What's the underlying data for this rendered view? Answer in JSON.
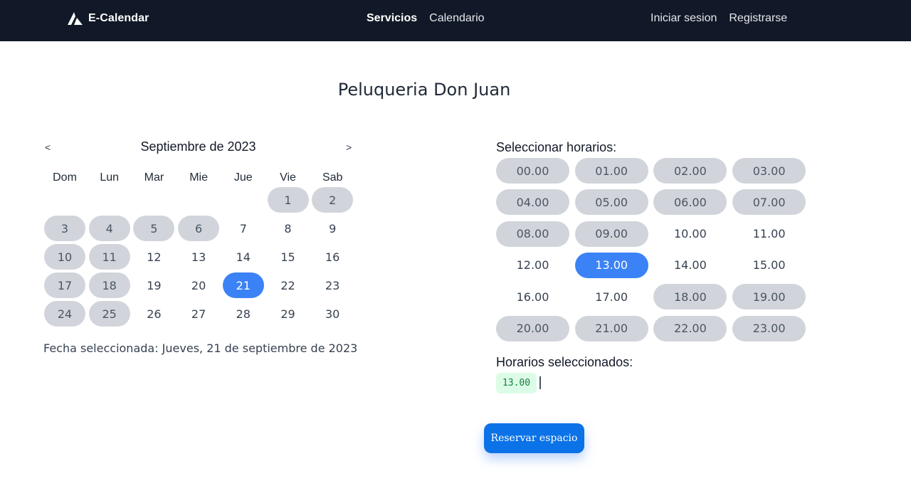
{
  "navbar": {
    "brand": "E-Calendar",
    "center_links": [
      {
        "label": "Servicios",
        "active": true
      },
      {
        "label": "Calendario",
        "active": false
      }
    ],
    "right_links": [
      {
        "label": "Iniciar sesion"
      },
      {
        "label": "Registrarse"
      }
    ]
  },
  "page": {
    "title": "Peluqueria Don Juan"
  },
  "calendar": {
    "prev": "<",
    "next": ">",
    "month_label": "Septiembre de 2023",
    "weekdays": [
      "Dom",
      "Lun",
      "Mar",
      "Mie",
      "Jue",
      "Vie",
      "Sab"
    ],
    "first_weekday_index": 5,
    "days_in_month": 30,
    "disabled_days": [
      1,
      2,
      3,
      4,
      5,
      6,
      10,
      11,
      17,
      18,
      24,
      25
    ],
    "selected_day": 21,
    "selected_date_text": "Fecha seleccionada: Jueves, 21 de septiembre de 2023"
  },
  "hours": {
    "title": "Seleccionar horarios:",
    "slots": [
      "00.00",
      "01.00",
      "02.00",
      "03.00",
      "04.00",
      "05.00",
      "06.00",
      "07.00",
      "08.00",
      "09.00",
      "10.00",
      "11.00",
      "12.00",
      "13.00",
      "14.00",
      "15.00",
      "16.00",
      "17.00",
      "18.00",
      "19.00",
      "20.00",
      "21.00",
      "22.00",
      "23.00"
    ],
    "disabled": [
      "00.00",
      "01.00",
      "02.00",
      "03.00",
      "04.00",
      "05.00",
      "06.00",
      "07.00",
      "08.00",
      "09.00",
      "18.00",
      "19.00",
      "20.00",
      "21.00",
      "22.00",
      "23.00"
    ],
    "selected": [
      "13.00"
    ]
  },
  "selection": {
    "title": "Horarios seleccionados:",
    "chips": [
      "13.00"
    ]
  },
  "actions": {
    "reserve_label": "Reservar espacio"
  },
  "colors": {
    "navbar_bg": "#111827",
    "accent": "#3b82f6",
    "disabled_bg": "#d1d5db",
    "chip_bg": "#dcfce7",
    "chip_text": "#15803d",
    "button_bg": "#0b72e7"
  }
}
